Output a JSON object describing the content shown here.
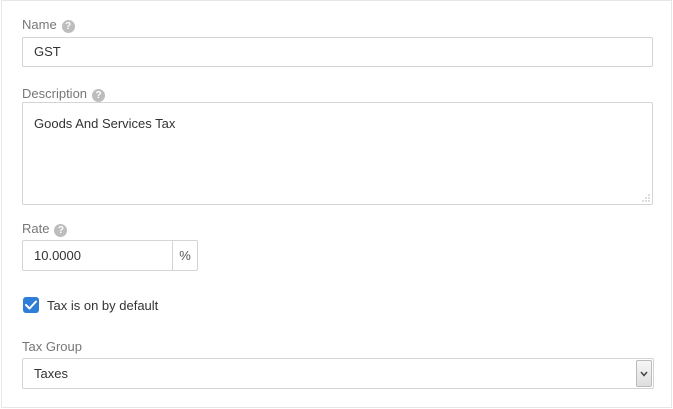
{
  "form": {
    "name": {
      "label": "Name",
      "help_icon": "question-circle-icon",
      "value": "GST"
    },
    "description": {
      "label": "Description",
      "help_icon": "question-circle-icon",
      "value": "Goods And Services Tax"
    },
    "rate": {
      "label": "Rate",
      "help_icon": "question-circle-icon",
      "value": "10.0000",
      "suffix": "%"
    },
    "default_checkbox": {
      "checked": true,
      "label": "Tax is on by default"
    },
    "tax_group": {
      "label": "Tax Group",
      "selected": "Taxes"
    }
  },
  "colors": {
    "checkbox_accent": "#2e7dd7",
    "label_text": "#777777",
    "input_border": "#d4d4d4"
  }
}
